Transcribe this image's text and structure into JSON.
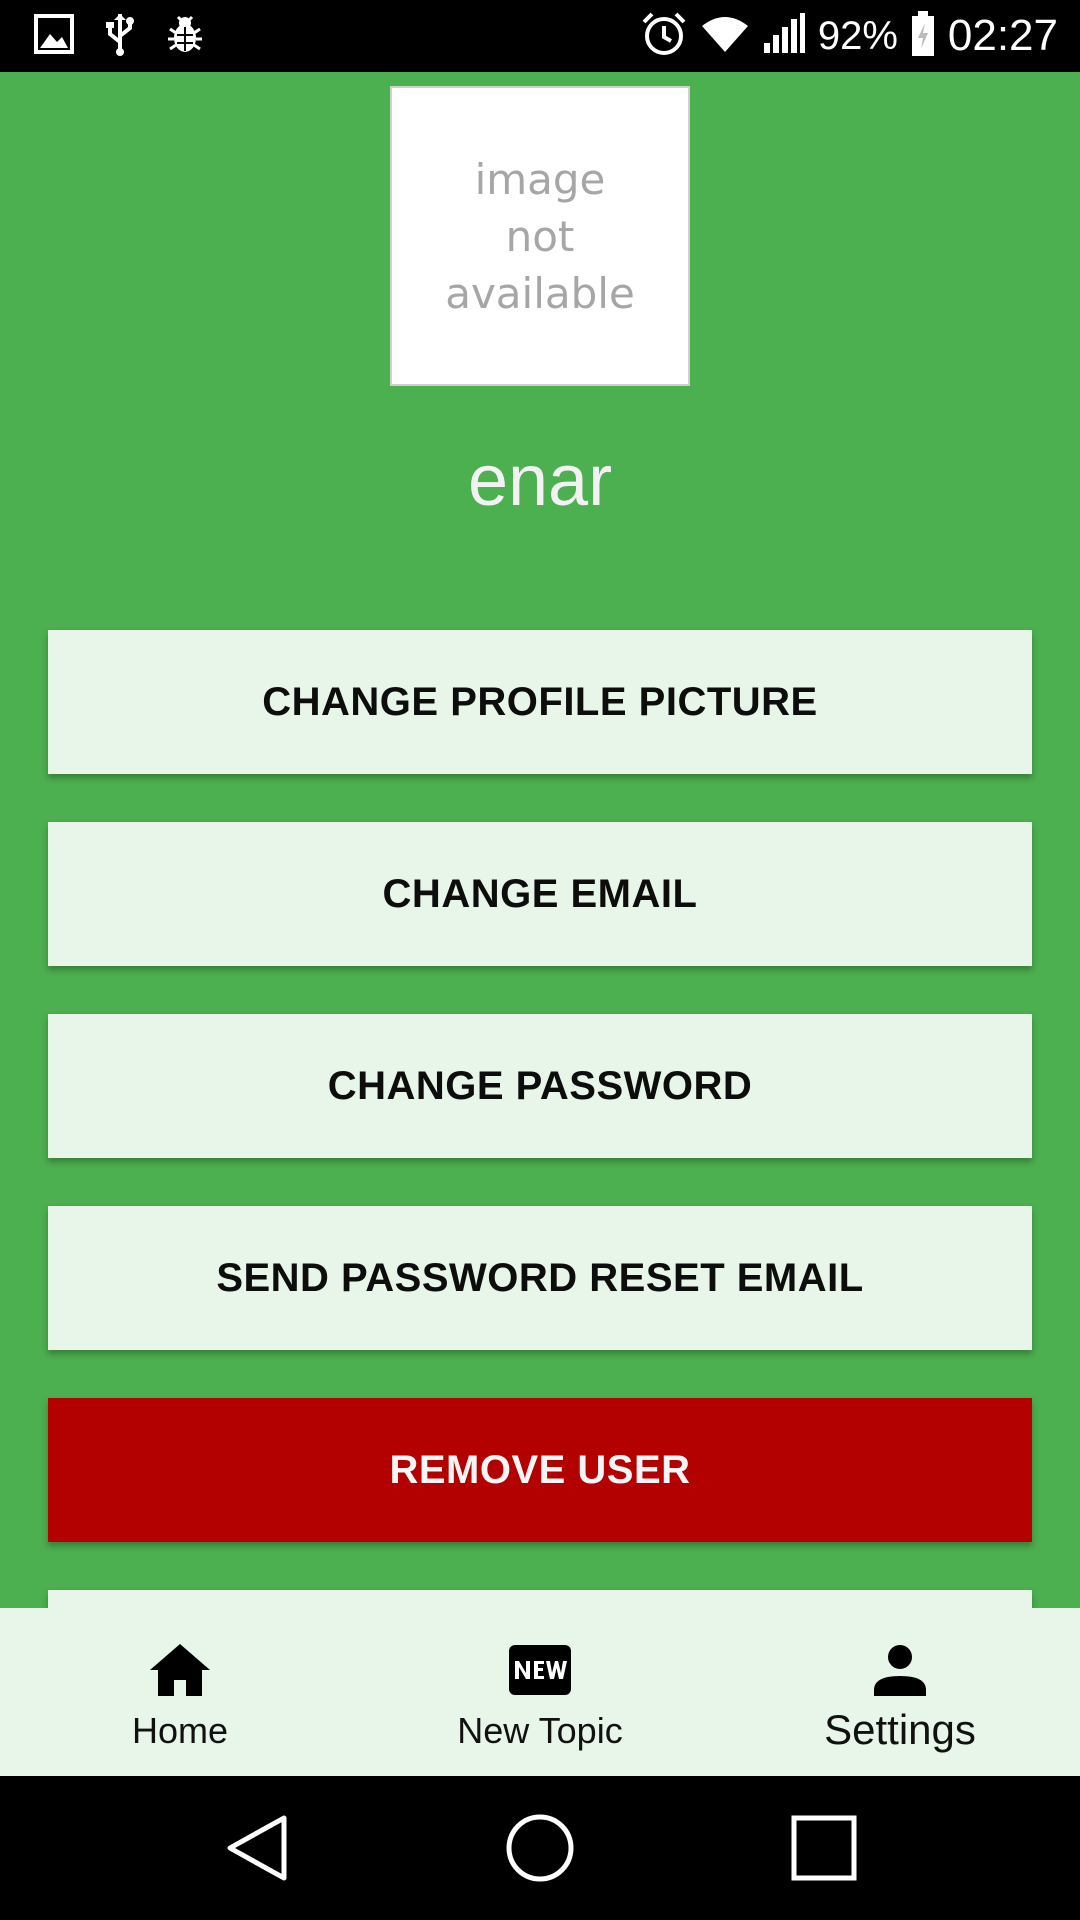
{
  "status_bar": {
    "battery": "92%",
    "time": "02:27"
  },
  "profile": {
    "avatar_placeholder_lines": [
      "image",
      "not",
      "available"
    ],
    "username": "enar"
  },
  "actions": {
    "change_profile_picture": "CHANGE PROFILE PICTURE",
    "change_email": "CHANGE EMAIL",
    "change_password": "CHANGE PASSWORD",
    "send_reset_email": "SEND PASSWORD RESET EMAIL",
    "remove_user": "REMOVE USER"
  },
  "bottom_nav": {
    "items": [
      {
        "label": "Home",
        "icon": "home-icon"
      },
      {
        "label": "New Topic",
        "icon": "new-badge-icon"
      },
      {
        "label": "Settings",
        "icon": "person-icon",
        "active": true
      }
    ]
  },
  "colors": {
    "background": "#4caf50",
    "button": "#e8f5e9",
    "danger": "#b30000",
    "nav_background": "#e8f5e9"
  }
}
